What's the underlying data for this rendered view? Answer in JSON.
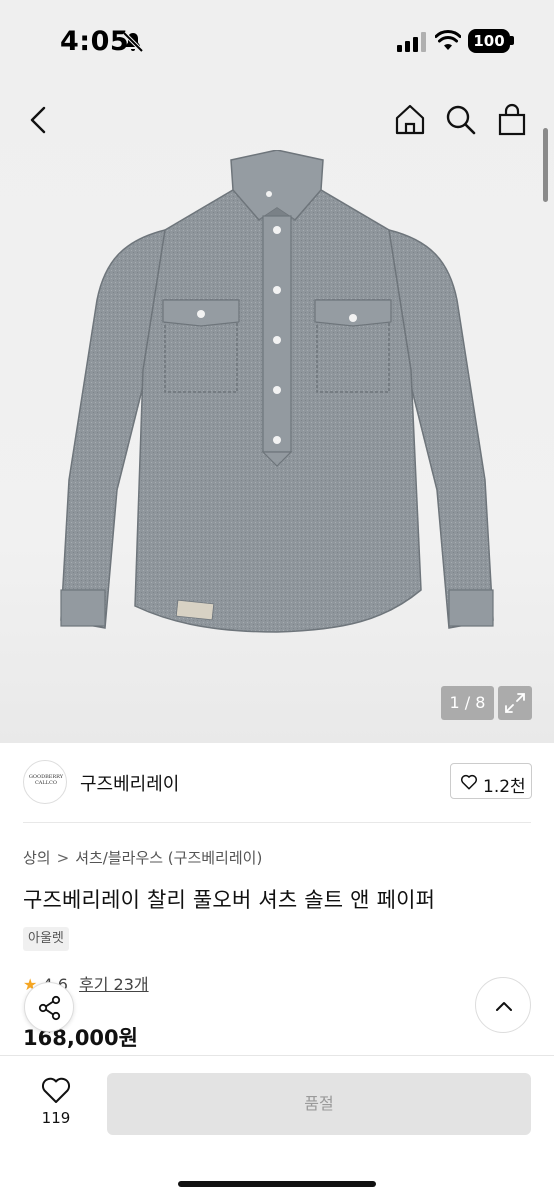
{
  "status_bar": {
    "time": "4:05",
    "battery": "100",
    "icons": [
      "bell-off-icon",
      "signal-icon",
      "wifi-icon",
      "battery-icon"
    ]
  },
  "top_nav": {
    "icons": [
      "back-icon",
      "home-icon",
      "search-icon",
      "bag-icon"
    ]
  },
  "gallery": {
    "counter": "1 / 8",
    "label_on_shirt": "GOODBERRY"
  },
  "store": {
    "logo_text": "GOODBERRY\nCALLCO",
    "name": "구즈베리레이",
    "like_count": "1.2천"
  },
  "product": {
    "breadcrumb": [
      "상의",
      "셔츠/블라우스 (구즈베리레이)"
    ],
    "breadcrumb_sep": ">",
    "title": "구즈베리레이 찰리 풀오버 셔츠 솔트 앤 페이퍼",
    "tag": "아울렛",
    "rating": "4.6",
    "reviews": "후기 23개",
    "price": "168,000원"
  },
  "bottom_bar": {
    "wish_count": "119",
    "button_label": "품절"
  },
  "colors": {
    "page_bg": "#ffffff",
    "hero_bg": "#efefef",
    "shirt": "#8f969c",
    "star": "#f5a623",
    "disabled_button": "#e3e3e3"
  }
}
